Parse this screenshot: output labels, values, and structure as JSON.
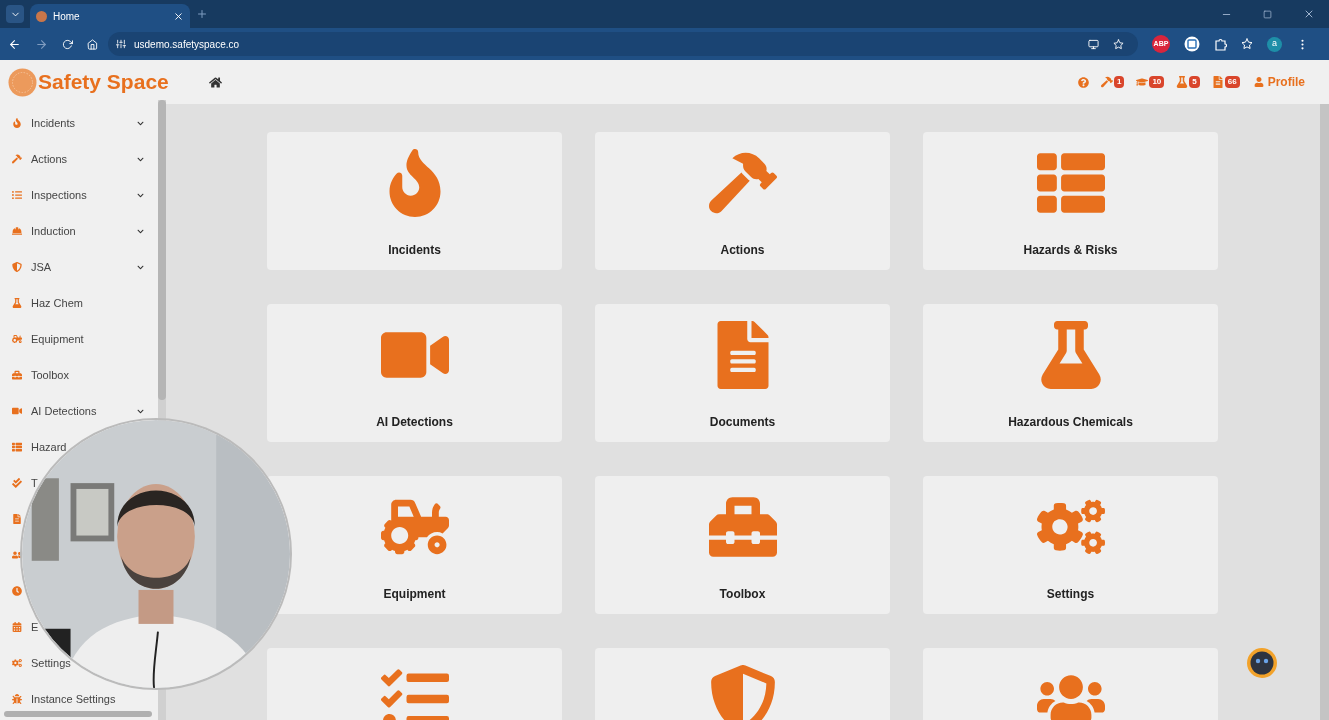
{
  "browser": {
    "tab": {
      "title": "Home"
    },
    "url": "usdemo.safetyspace.co",
    "extension_badge": "ABP",
    "profile_initial": "a"
  },
  "app": {
    "logo_text": "Safety Space",
    "header": {
      "badges": [
        {
          "count": "1"
        },
        {
          "count": "10"
        },
        {
          "count": "5"
        },
        {
          "count": "66"
        }
      ],
      "profile": "Profile"
    }
  },
  "sidebar": {
    "items": [
      {
        "label": "Incidents",
        "expandable": true
      },
      {
        "label": "Actions",
        "expandable": true
      },
      {
        "label": "Inspections",
        "expandable": true
      },
      {
        "label": "Induction",
        "expandable": true
      },
      {
        "label": "JSA",
        "expandable": true
      },
      {
        "label": "Haz Chem",
        "expandable": false
      },
      {
        "label": "Equipment",
        "expandable": false
      },
      {
        "label": "Toolbox",
        "expandable": false
      },
      {
        "label": "AI Detections",
        "expandable": true
      },
      {
        "kind": "labeled",
        "label": "Hazard"
      },
      {
        "kind": "labeled",
        "label": "T"
      },
      {
        "kind": "icon_only"
      },
      {
        "kind": "icon_only"
      },
      {
        "kind": "icon_only"
      },
      {
        "kind": "labeled",
        "label": "E"
      },
      {
        "kind": "labeled",
        "label": "Settings"
      },
      {
        "label": "Instance Settings",
        "expandable": false
      }
    ]
  },
  "tiles": [
    {
      "kind": "labeled",
      "label": "Incidents"
    },
    {
      "kind": "labeled",
      "label": "Actions"
    },
    {
      "kind": "labeled",
      "label": "Hazards & Risks"
    },
    {
      "kind": "labeled",
      "label": "AI Detections"
    },
    {
      "kind": "labeled",
      "label": "Documents"
    },
    {
      "kind": "labeled",
      "label": "Hazardous Chemicals"
    },
    {
      "kind": "labeled",
      "label": "Equipment"
    },
    {
      "kind": "labeled",
      "label": "Toolbox"
    },
    {
      "kind": "labeled",
      "label": "Settings"
    },
    {
      "kind": "cut_off"
    },
    {
      "kind": "cut_off"
    },
    {
      "kind": "cut_off"
    }
  ]
}
